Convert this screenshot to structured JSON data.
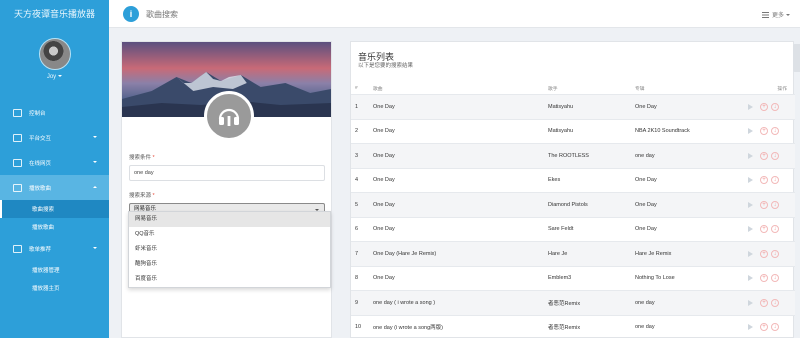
{
  "app": {
    "title": "天方夜谭音乐播放器"
  },
  "user": {
    "name": "Joy"
  },
  "sidebar": {
    "items": [
      {
        "label": "控制台",
        "icon": "home-icon",
        "has_children": false
      },
      {
        "label": "平台交互",
        "icon": "layout-icon",
        "has_children": true
      },
      {
        "label": "在线网页",
        "icon": "globe-icon",
        "has_children": true
      },
      {
        "label": "播放歌曲",
        "icon": "music-icon",
        "has_children": true,
        "active": true,
        "children": [
          {
            "label": "歌曲搜索",
            "current": true
          },
          {
            "label": "播放歌曲"
          }
        ]
      },
      {
        "label": "歌单推荐",
        "icon": "grid-icon",
        "has_children": true,
        "children": [
          {
            "label": "播放器管理"
          },
          {
            "label": "播放器主页"
          }
        ]
      }
    ]
  },
  "topbar": {
    "title": "歌曲搜索",
    "info_icon": "i",
    "more_label": "更多"
  },
  "search": {
    "keyword_label": "搜索条件",
    "keyword_value": "one day",
    "source_label": "搜索来源",
    "source_selected": "网易音乐",
    "options": [
      "网易音乐",
      "QQ音乐",
      "虾米音乐",
      "酷狗音乐",
      "百度音乐"
    ],
    "required_mark": "*"
  },
  "results": {
    "title": "音乐列表",
    "subtitle": "以下是您要的搜索结果",
    "headers": {
      "no": "#",
      "song": "歌曲",
      "artist": "歌手",
      "album": "专辑",
      "ops": "操作"
    },
    "rows": [
      {
        "no": "1",
        "song": "One Day",
        "artist": "Matisyahu",
        "album": "One Day"
      },
      {
        "no": "2",
        "song": "One Day",
        "artist": "Matisyahu",
        "album": "NBA 2K10 Soundtrack"
      },
      {
        "no": "3",
        "song": "One Day",
        "artist": "The ROOTLESS",
        "album": "one day"
      },
      {
        "no": "4",
        "song": "One Day",
        "artist": "Ekes",
        "album": "One Day"
      },
      {
        "no": "5",
        "song": "One Day",
        "artist": "Diamond Pistols",
        "album": "One Day"
      },
      {
        "no": "6",
        "song": "One Day",
        "artist": "Sare Feldt",
        "album": "One Day"
      },
      {
        "no": "7",
        "song": "One Day (Hare Je Remix)",
        "artist": "Hare Je",
        "album": "Hare Je Remix"
      },
      {
        "no": "8",
        "song": "One Day",
        "artist": "Emblem3",
        "album": "Nothing To Lose"
      },
      {
        "no": "9",
        "song": "one day ( i wrote a song )",
        "artist": "者恶范Remix",
        "album": "one day"
      },
      {
        "no": "10",
        "song": "one day (i wrote a song两版)",
        "artist": "者恶范Remix",
        "album": "one day"
      }
    ]
  },
  "colors": {
    "sidebar": "#2d9fd9",
    "accent": "#2d9fd9",
    "required": "#e74c3c"
  }
}
